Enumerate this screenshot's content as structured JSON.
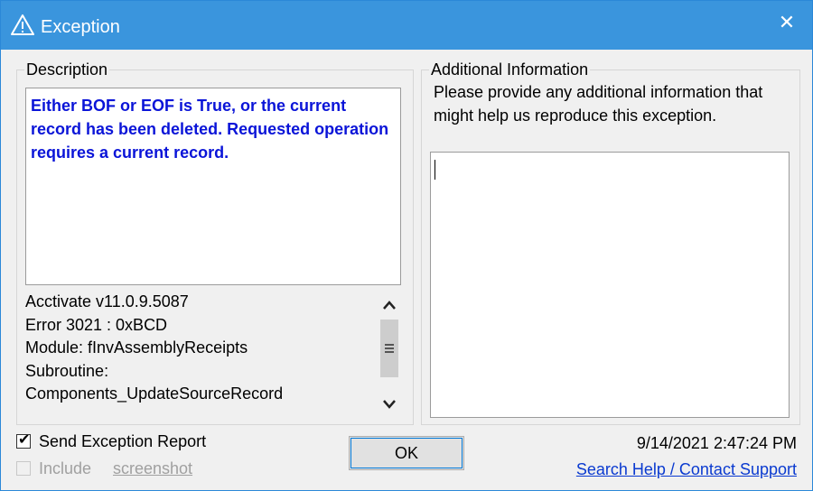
{
  "window": {
    "title": "Exception",
    "title_icon": "warning-icon",
    "close_glyph": "✕"
  },
  "description": {
    "label": "Description",
    "message": "Either BOF or EOF is True, or the current record has been deleted. Requested operation requires a current record.",
    "details": [
      "Acctivate v11.0.9.5087",
      "Error 3021 : 0xBCD",
      "Module: fInvAssemblyReceipts",
      "Subroutine:",
      "Components_UpdateSourceRecord"
    ]
  },
  "additional": {
    "label": "Additional Information",
    "prompt": "Please provide any additional information that might help us reproduce this exception.",
    "value": ""
  },
  "footer": {
    "send_report_label": "Send Exception Report",
    "send_report_checked": true,
    "include_label": "Include",
    "screenshot_label": "screenshot",
    "include_checked": false,
    "ok_label": "OK",
    "timestamp": "9/14/2021 2:47:24 PM",
    "support_link": "Search Help / Contact Support"
  },
  "colors": {
    "titlebar": "#3a95dd",
    "message_text": "#0a14d8",
    "link": "#0a3ad0"
  }
}
